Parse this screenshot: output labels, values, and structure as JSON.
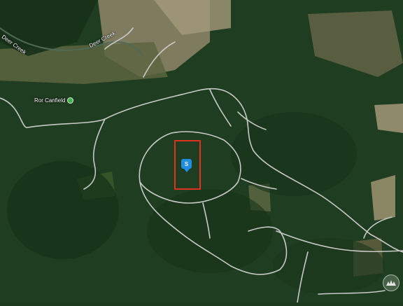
{
  "map": {
    "labels": {
      "deer_creek_left": "Deer Creek",
      "deer_creek_right": "Deer Creek",
      "poi_name": "Ror Canfield"
    },
    "marker": {
      "text": "S"
    },
    "colors": {
      "forest": "#1d3a1e",
      "road": "#c9c9c9",
      "parcel_outline": "#e0311f",
      "marker": "#1f8fe3",
      "poi": "#3fb24a"
    },
    "brand_logo": "mountain-logo-icon"
  }
}
